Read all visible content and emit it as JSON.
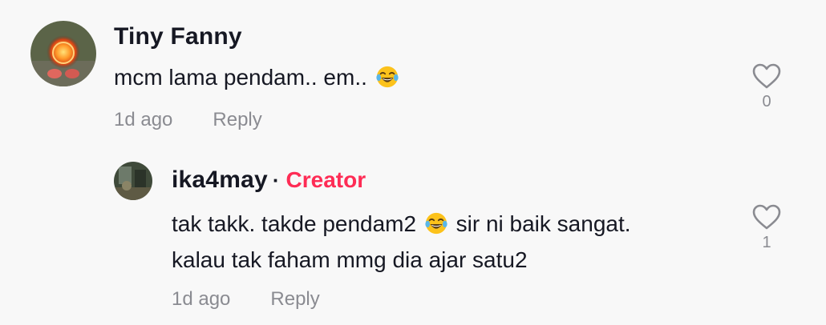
{
  "comments": [
    {
      "username": "Tiny Fanny",
      "text": "mcm lama pendam.. em..",
      "emoji": "tears-of-joy",
      "time": "1d ago",
      "reply_label": "Reply",
      "likes": "0"
    },
    {
      "username": "ika4may",
      "badge": "Creator",
      "text_line1_a": "tak takk. takde pendam2",
      "text_line1_b": "sir ni baik sangat.",
      "text_line2": "kalau tak faham mmg dia ajar satu2",
      "emoji": "tears-of-joy",
      "time": "1d ago",
      "reply_label": "Reply",
      "likes": "1"
    }
  ],
  "icons": {
    "like": "heart-outline-icon",
    "emoji": "tears-of-joy-emoji"
  },
  "colors": {
    "background": "#f8f8f8",
    "text": "#161823",
    "muted": "#8a8b91",
    "creator": "#fe2c55"
  }
}
